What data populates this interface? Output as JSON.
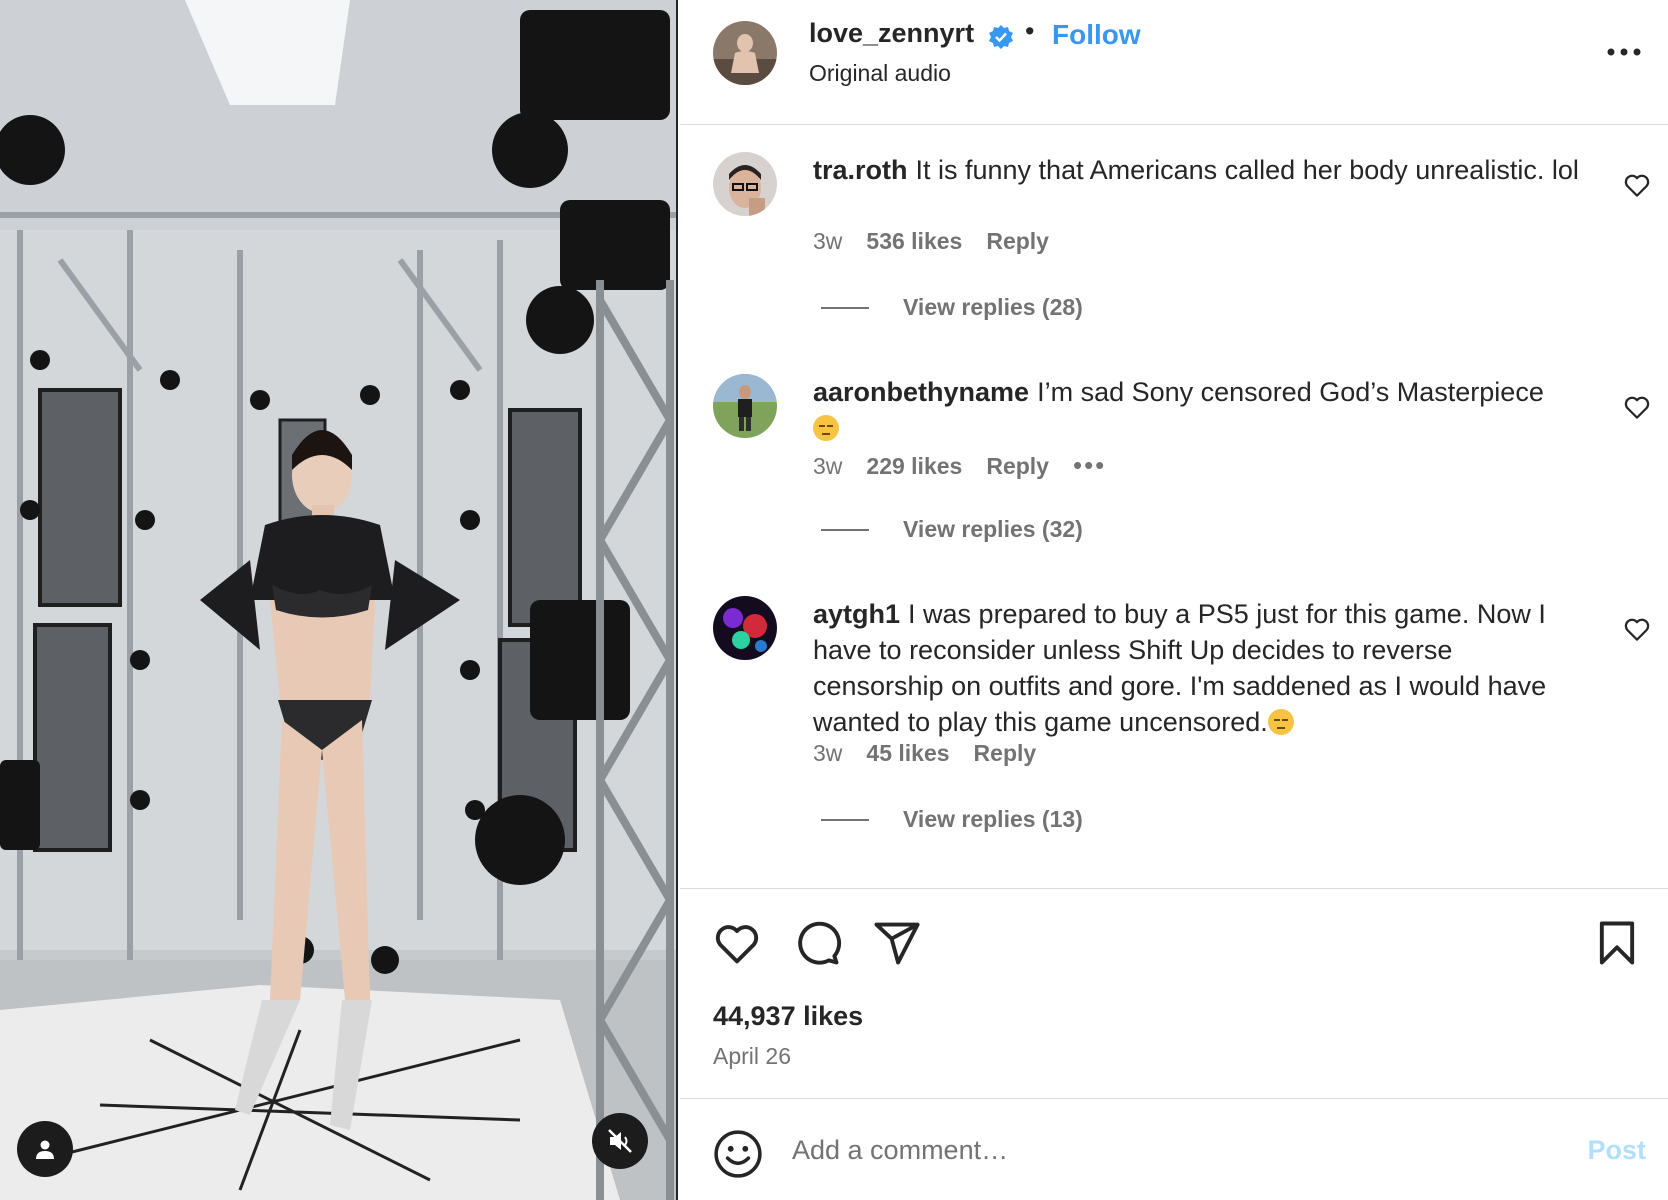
{
  "post": {
    "username": "love_zennyrt",
    "verified": true,
    "separator": "•",
    "follow_label": "Follow",
    "audio": "Original audio",
    "more_icon": "more-horizontal-icon"
  },
  "comments": [
    {
      "username": "tra.roth",
      "text": "It is funny that Americans called her body unrealistic. lol",
      "age": "3w",
      "likes": "536 likes",
      "reply_label": "Reply",
      "view_replies": "View replies (28)"
    },
    {
      "username": "aaronbethyname",
      "text": "I’m sad Sony censored God’s Masterpiece",
      "emoji": "pensive-face-emoji",
      "age": "3w",
      "likes": "229 likes",
      "reply_label": "Reply",
      "more": "•••",
      "view_replies": "View replies (32)"
    },
    {
      "username": "aytgh1",
      "text": "I was prepared to buy a PS5 just for this game. Now I have to reconsider unless Shift Up decides to reverse censorship on outfits and gore. I'm saddened as I would have wanted to play this game uncensored.",
      "emoji": "pensive-face-emoji",
      "age": "3w",
      "likes": "45 likes",
      "reply_label": "Reply",
      "view_replies": "View replies (13)"
    }
  ],
  "actions": {
    "like_icon": "heart-icon",
    "comment_icon": "comment-bubble-icon",
    "share_icon": "paper-plane-icon",
    "save_icon": "bookmark-icon"
  },
  "likes_total": "44,937 likes",
  "date": "April 26",
  "add_comment": {
    "placeholder": "Add a comment…",
    "post_label": "Post"
  },
  "media_controls": {
    "user_icon": "user-tag-icon",
    "mute_icon": "muted-speaker-icon"
  },
  "colors": {
    "follow": "#3897f0",
    "verified": "#3897f0",
    "secondary_text": "#737373",
    "post_disabled": "#b2dffc"
  }
}
